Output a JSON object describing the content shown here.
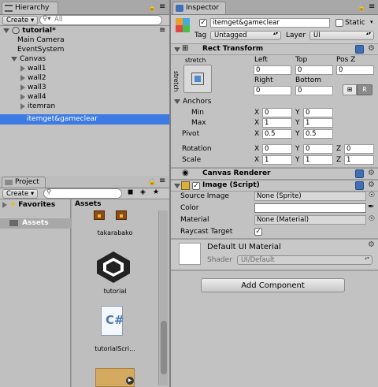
{
  "hierarchy": {
    "tab_label": "Hierarchy",
    "create_label": "Create",
    "search_placeholder": "All",
    "scene_name": "tutorial*",
    "items": [
      {
        "label": "Main Camera"
      },
      {
        "label": "EventSystem"
      },
      {
        "label": "Canvas"
      },
      {
        "label": "wall1"
      },
      {
        "label": "wall2"
      },
      {
        "label": "wall3"
      },
      {
        "label": "wall4"
      },
      {
        "label": "itemran"
      },
      {
        "label": "itemget&gameclear"
      }
    ]
  },
  "project": {
    "tab_label": "Project",
    "create_label": "Create",
    "favorites_label": "Favorites",
    "assets_label": "Assets",
    "assets_header": "Assets",
    "asset_items": [
      {
        "label": "takarabako",
        "icon": "treasure-chest-icon"
      },
      {
        "label": "tutorial",
        "icon": "unity-logo-icon"
      },
      {
        "label": "tutorialScri...",
        "icon": "csharp-script-icon"
      },
      {
        "label": "",
        "icon": "audio-clip-icon"
      }
    ]
  },
  "inspector": {
    "tab_label": "Inspector",
    "object_name": "itemget&gameclear",
    "active": true,
    "static_label": "Static",
    "tag_label": "Tag",
    "tag_value": "Untagged",
    "layer_label": "Layer",
    "layer_value": "UI",
    "rect_transform": {
      "title": "Rect Transform",
      "anchor_preset_top": "stretch",
      "anchor_preset_side": "stretch",
      "left_label": "Left",
      "top_label": "Top",
      "posz_label": "Pos Z",
      "left": "0",
      "top": "0",
      "posz": "0",
      "right_label": "Right",
      "bottom_label": "Bottom",
      "right": "0",
      "bottom": "0",
      "r_button": "R",
      "anchors_label": "Anchors",
      "min_label": "Min",
      "max_label": "Max",
      "min_x": "0",
      "min_y": "0",
      "max_x": "1",
      "max_y": "1",
      "pivot_label": "Pivot",
      "pivot_x": "0.5",
      "pivot_y": "0.5",
      "rotation_label": "Rotation",
      "rot_x": "0",
      "rot_y": "0",
      "rot_z": "0",
      "scale_label": "Scale",
      "scale_x": "1",
      "scale_y": "1",
      "scale_z": "1",
      "x": "X",
      "y": "Y",
      "z": "Z"
    },
    "canvas_renderer": {
      "title": "Canvas Renderer"
    },
    "image": {
      "title": "Image (Script)",
      "source_label": "Source Image",
      "source_value": "None (Sprite)",
      "color_label": "Color",
      "color_value": "#ffffff",
      "material_label": "Material",
      "material_value": "None (Material)",
      "raycast_label": "Raycast Target",
      "raycast": true
    },
    "material": {
      "name": "Default UI Material",
      "shader_label": "Shader",
      "shader_value": "UI/Default"
    },
    "add_component": "Add Component"
  }
}
